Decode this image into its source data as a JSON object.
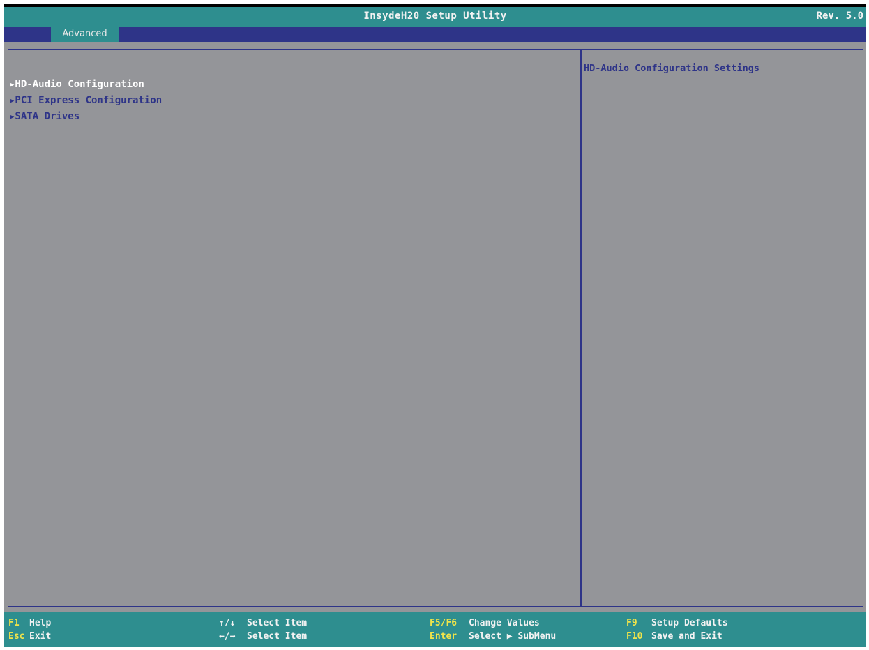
{
  "title_bar": {
    "title": "InsydeH20 Setup Utility",
    "revision": "Rev. 5.0"
  },
  "tabs": [
    {
      "label": "Advanced",
      "active": true
    }
  ],
  "menu": {
    "items": [
      {
        "label": "HD-Audio Configuration",
        "selected": true,
        "icon": "submenu-triangle-icon"
      },
      {
        "label": "PCI Express Configuration",
        "selected": false,
        "icon": "submenu-triangle-icon"
      },
      {
        "label": "SATA Drives",
        "selected": false,
        "icon": "submenu-triangle-icon"
      }
    ]
  },
  "help": {
    "text": "HD-Audio Configuration Settings"
  },
  "footer": {
    "columns": [
      [
        {
          "key": "F1",
          "desc": "Help"
        },
        {
          "key": "Esc",
          "desc": "Exit"
        }
      ],
      [
        {
          "key": "↑/↓",
          "desc": "Select Item"
        },
        {
          "key": "←/→",
          "desc": "Select Item"
        }
      ],
      [
        {
          "key": "F5/F6",
          "desc": "Change Values"
        },
        {
          "key": "Enter",
          "desc": "Select ▶ SubMenu"
        }
      ],
      [
        {
          "key": "F9",
          "desc": "Setup Defaults"
        },
        {
          "key": "F10",
          "desc": "Save and Exit"
        }
      ]
    ]
  },
  "colors": {
    "background": "#949599",
    "teal": "#2e8e8f",
    "navy": "#2e3488",
    "key_yellow": "#f0e44a",
    "selected_text": "#ffffff"
  }
}
